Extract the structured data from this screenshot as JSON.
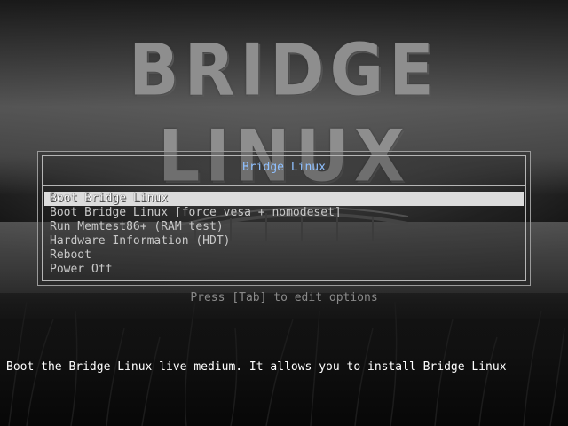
{
  "logo": {
    "text": "BRIDGE LINUX"
  },
  "menu": {
    "title": "Bridge Linux",
    "items": [
      {
        "label": "Boot Bridge Linux"
      },
      {
        "label": "Boot Bridge Linux [force vesa + nomodeset]"
      },
      {
        "label": "Run Memtest86+ (RAM test)"
      },
      {
        "label": "Hardware Information (HDT)"
      },
      {
        "label": "Reboot"
      },
      {
        "label": "Power Off"
      }
    ],
    "selected_index": 0
  },
  "hint": "Press [Tab] to edit options",
  "help_text": "Boot the Bridge Linux live medium. It allows you to install Bridge Linux",
  "colors": {
    "title": "#8fc0ff",
    "selection": "#dcdcdc",
    "border": "#b5b5b5"
  }
}
